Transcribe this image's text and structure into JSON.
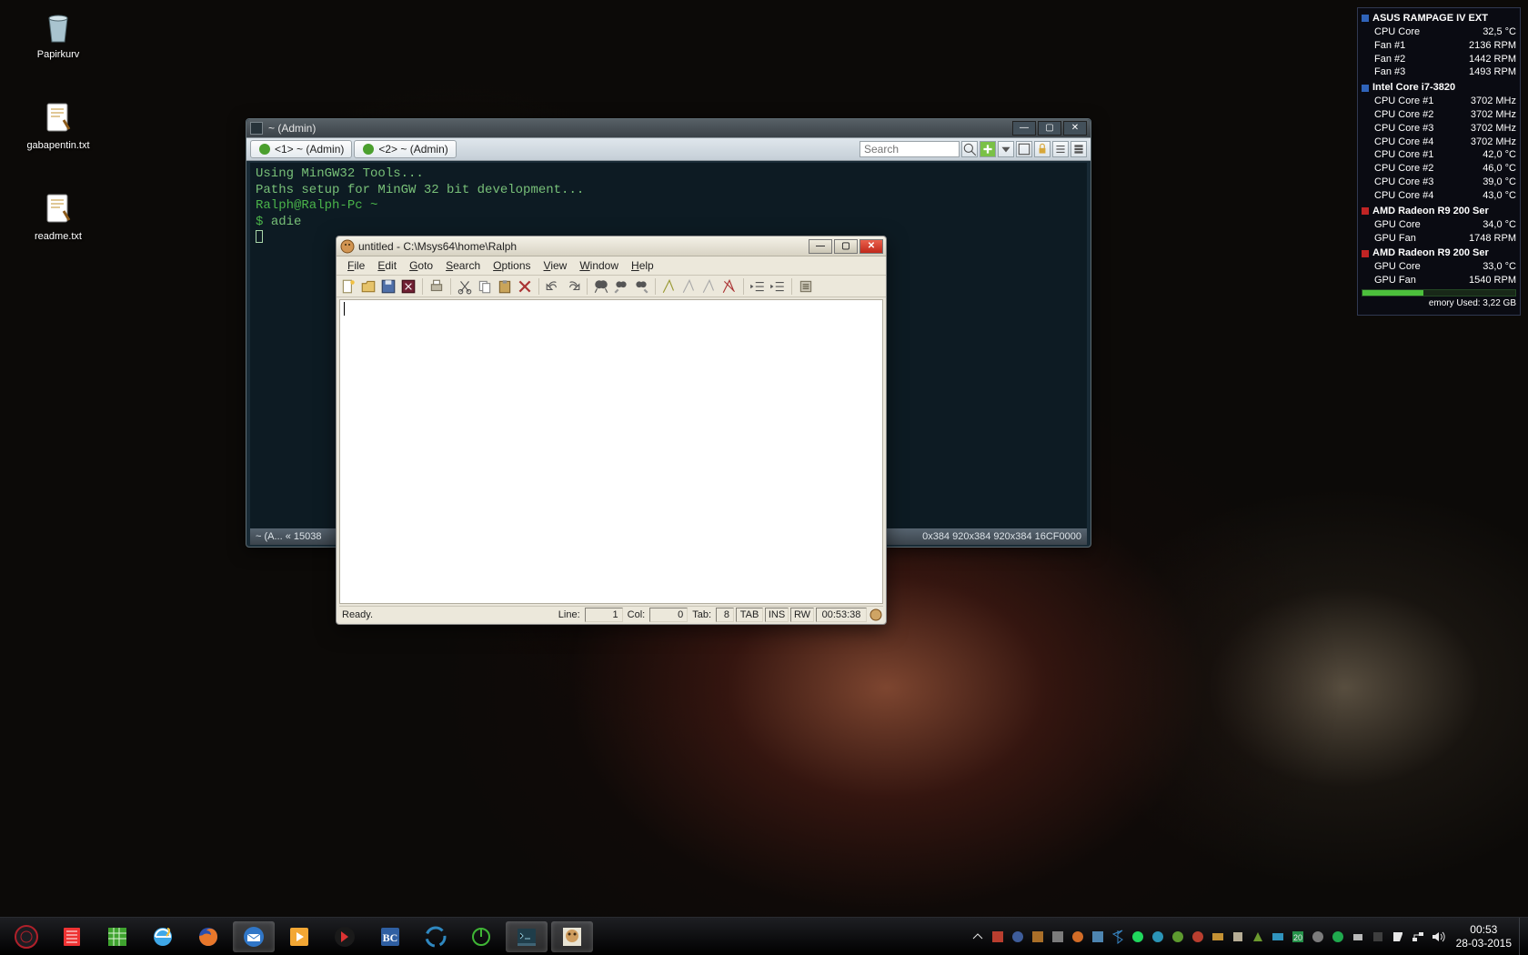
{
  "desktop": {
    "icons": [
      {
        "name": "papirkurv",
        "label": "Papirkurv",
        "kind": "recycle-bin"
      },
      {
        "name": "gabapentin",
        "label": "gabapentin.txt",
        "kind": "textfile"
      },
      {
        "name": "readme",
        "label": "readme.txt",
        "kind": "textfile"
      }
    ]
  },
  "terminal": {
    "title": "~ (Admin)",
    "tabs": [
      {
        "label": "<1> ~ (Admin)"
      },
      {
        "label": "<2> ~ (Admin)"
      }
    ],
    "search_placeholder": "Search",
    "lines": [
      "Using MinGW32 Tools...",
      "Paths setup for MinGW 32 bit development...",
      "",
      "Ralph@Ralph-Pc ~",
      "$ adie"
    ],
    "status_left": "~ (A...  « 15038",
    "status_right": "0x384  920x384  920x384  16CF0000"
  },
  "adie": {
    "title": "untitled - C:\\Msys64\\home\\Ralph",
    "menu": [
      "File",
      "Edit",
      "Goto",
      "Search",
      "Options",
      "View",
      "Window",
      "Help"
    ],
    "status": {
      "ready": "Ready.",
      "line_label": "Line:",
      "line_value": "1",
      "col_label": "Col:",
      "col_value": "0",
      "tab_label": "Tab:",
      "tab_value": "8",
      "mode_tab": "TAB",
      "mode_ins": "INS",
      "mode_rw": "RW",
      "clock": "00:53:38"
    }
  },
  "hwmon": {
    "sections": [
      {
        "chip": "blue",
        "title": "ASUS RAMPAGE IV EXT",
        "rows": [
          [
            "CPU Core",
            "32,5 °C"
          ],
          [
            "Fan #1",
            "2136 RPM"
          ],
          [
            "Fan #2",
            "1442 RPM"
          ],
          [
            "Fan #3",
            "1493 RPM"
          ]
        ]
      },
      {
        "chip": "blue",
        "title": "Intel Core i7-3820",
        "rows": [
          [
            "CPU Core #1",
            "3702 MHz"
          ],
          [
            "CPU Core #2",
            "3702 MHz"
          ],
          [
            "CPU Core #3",
            "3702 MHz"
          ],
          [
            "CPU Core #4",
            "3702 MHz"
          ],
          [
            "CPU Core #1",
            "42,0 °C"
          ],
          [
            "CPU Core #2",
            "46,0 °C"
          ],
          [
            "CPU Core #3",
            "39,0 °C"
          ],
          [
            "CPU Core #4",
            "43,0 °C"
          ]
        ]
      },
      {
        "chip": "red",
        "title": "AMD Radeon R9 200 Ser",
        "rows": [
          [
            "GPU Core",
            "34,0 °C"
          ],
          [
            "GPU Fan",
            "1748 RPM"
          ]
        ]
      },
      {
        "chip": "red",
        "title": "AMD Radeon R9 200 Ser",
        "rows": [
          [
            "GPU Core",
            "33,0 °C"
          ],
          [
            "GPU Fan",
            "1540 RPM"
          ]
        ]
      }
    ],
    "mem_label": "emory Used: 3,22 GB"
  },
  "taskbar": {
    "clock_time": "00:53",
    "clock_date": "28-03-2015"
  }
}
